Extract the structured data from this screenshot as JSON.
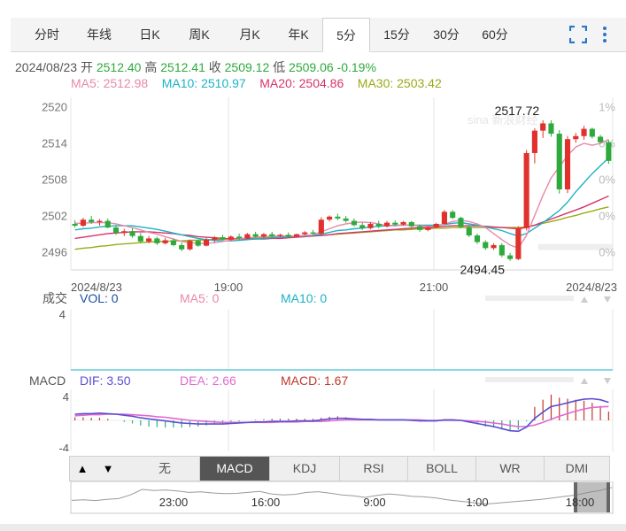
{
  "tabs": [
    "分时",
    "年线",
    "日K",
    "周K",
    "月K",
    "年K",
    "5分",
    "15分",
    "30分",
    "60分"
  ],
  "active_tab": "5分",
  "toolbar": {
    "fullscreen_icon": "fullscreen-icon",
    "more_icon": "more-vertical-icon"
  },
  "quote": {
    "date": "2024/08/23",
    "open_label": "开",
    "open": "2512.40",
    "high_label": "高",
    "high": "2512.41",
    "close_label": "收",
    "close": "2509.12",
    "low_label": "低",
    "low": "2509.06",
    "change": "-0.19%"
  },
  "ma": [
    {
      "label": "MA5: 2512.98",
      "color": "#e889a8"
    },
    {
      "label": "MA10: 2510.97",
      "color": "#1ab3c5"
    },
    {
      "label": "MA20: 2504.86",
      "color": "#d6336c"
    },
    {
      "label": "MA30: 2503.42",
      "color": "#9aaa16"
    }
  ],
  "watermark": "sina 新浪财经",
  "volume": {
    "title": "成交",
    "vol": "VOL: 0",
    "ma5": "MA5: 0",
    "ma10": "MA10: 0",
    "ytick": "4"
  },
  "macd": {
    "title": "MACD",
    "dif": "DIF: 3.50",
    "dea": "DEA: 2.66",
    "macd": "MACD: 1.67",
    "yticks": [
      "4",
      "-4"
    ]
  },
  "indicator_tabs": [
    "无",
    "MACD",
    "KDJ",
    "RSI",
    "BOLL",
    "WR",
    "DMI"
  ],
  "active_indicator": "MACD",
  "nav_arrows": [
    "▲",
    "▼"
  ],
  "navigator_labels": [
    "23:00",
    "16:00",
    "9:00",
    "1:00",
    "18:00"
  ],
  "colors": {
    "up": "#e0312c",
    "down": "#2eaa3c",
    "dif": "#5b4fd1",
    "dea": "#e06ad0",
    "accent": "#2c74c8"
  },
  "chart_data": [
    {
      "type": "candlestick",
      "title": "",
      "yticks": [
        2520,
        2514,
        2508,
        2502,
        2496
      ],
      "ylim": [
        2493.0,
        2521.5
      ],
      "pct_ticks": [
        "1%",
        "0%",
        "0%",
        "0%",
        "0%"
      ],
      "xlabels": [
        "2024/8/23",
        "19:00",
        "21:00",
        "2024/8/23"
      ],
      "annotations": {
        "max": "2517.72",
        "min": "2494.45"
      },
      "ohlc": [
        [
          2500.6,
          2501.2,
          2500.0,
          2500.3
        ],
        [
          2500.3,
          2501.6,
          2500.1,
          2501.3
        ],
        [
          2501.3,
          2501.9,
          2500.6,
          2500.9
        ],
        [
          2500.9,
          2501.4,
          2500.3,
          2501.1
        ],
        [
          2501.1,
          2501.5,
          2499.9,
          2500.0
        ],
        [
          2500.0,
          2500.4,
          2498.8,
          2499.1
        ],
        [
          2499.1,
          2499.8,
          2498.6,
          2499.4
        ],
        [
          2499.4,
          2499.9,
          2498.3,
          2498.6
        ],
        [
          2498.6,
          2499.1,
          2497.4,
          2497.7
        ],
        [
          2497.7,
          2498.6,
          2497.4,
          2498.2
        ],
        [
          2498.2,
          2498.5,
          2497.1,
          2497.4
        ],
        [
          2497.4,
          2498.3,
          2497.2,
          2497.9
        ],
        [
          2497.9,
          2498.2,
          2496.9,
          2497.1
        ],
        [
          2497.1,
          2497.5,
          2496.1,
          2496.4
        ],
        [
          2496.4,
          2498.0,
          2496.2,
          2497.8
        ],
        [
          2497.8,
          2498.0,
          2496.8,
          2497.0
        ],
        [
          2497.0,
          2498.3,
          2496.9,
          2498.0
        ],
        [
          2498.0,
          2498.6,
          2497.5,
          2498.4
        ],
        [
          2498.4,
          2498.8,
          2497.8,
          2498.0
        ],
        [
          2498.0,
          2498.7,
          2497.8,
          2498.5
        ],
        [
          2498.5,
          2499.0,
          2497.9,
          2498.2
        ],
        [
          2498.2,
          2499.1,
          2498.1,
          2498.9
        ],
        [
          2498.9,
          2499.3,
          2498.3,
          2498.5
        ],
        [
          2498.5,
          2499.1,
          2498.3,
          2498.9
        ],
        [
          2498.9,
          2499.3,
          2498.4,
          2498.6
        ],
        [
          2498.6,
          2499.0,
          2498.4,
          2498.8
        ],
        [
          2498.8,
          2499.2,
          2498.3,
          2498.5
        ],
        [
          2498.5,
          2499.0,
          2498.4,
          2498.9
        ],
        [
          2498.9,
          2499.4,
          2498.7,
          2499.2
        ],
        [
          2499.2,
          2499.6,
          2498.8,
          2499.0
        ],
        [
          2499.0,
          2501.7,
          2498.9,
          2501.3
        ],
        [
          2501.3,
          2502.0,
          2501.0,
          2501.8
        ],
        [
          2501.8,
          2502.3,
          2501.2,
          2501.5
        ],
        [
          2501.5,
          2501.9,
          2500.8,
          2501.1
        ],
        [
          2501.1,
          2501.5,
          2500.2,
          2500.4
        ],
        [
          2500.4,
          2500.8,
          2499.6,
          2499.9
        ],
        [
          2499.9,
          2500.9,
          2499.7,
          2500.6
        ],
        [
          2500.6,
          2501.1,
          2499.9,
          2500.2
        ],
        [
          2500.2,
          2501.1,
          2500.0,
          2500.8
        ],
        [
          2500.8,
          2501.2,
          2500.2,
          2500.5
        ],
        [
          2500.5,
          2501.1,
          2500.3,
          2500.9
        ],
        [
          2500.9,
          2501.1,
          2500.0,
          2500.2
        ],
        [
          2500.2,
          2500.5,
          2499.3,
          2499.6
        ],
        [
          2499.6,
          2500.2,
          2499.4,
          2500.0
        ],
        [
          2500.0,
          2500.8,
          2499.9,
          2500.6
        ],
        [
          2500.6,
          2502.9,
          2500.5,
          2502.6
        ],
        [
          2502.6,
          2502.9,
          2501.4,
          2501.6
        ],
        [
          2501.6,
          2501.8,
          2499.9,
          2500.1
        ],
        [
          2500.1,
          2500.4,
          2498.4,
          2498.7
        ],
        [
          2498.7,
          2499.0,
          2497.3,
          2497.6
        ],
        [
          2497.6,
          2497.9,
          2496.3,
          2496.6
        ],
        [
          2496.6,
          2497.4,
          2496.3,
          2497.1
        ],
        [
          2497.1,
          2497.4,
          2495.1,
          2495.4
        ],
        [
          2495.4,
          2495.8,
          2494.5,
          2494.8
        ],
        [
          2494.8,
          2500.2,
          2494.6,
          2499.9
        ],
        [
          2499.9,
          2512.8,
          2499.5,
          2512.3
        ],
        [
          2512.3,
          2516.4,
          2510.6,
          2516.0
        ],
        [
          2516.0,
          2517.7,
          2514.8,
          2517.2
        ],
        [
          2517.2,
          2517.7,
          2515.0,
          2515.5
        ],
        [
          2515.5,
          2516.1,
          2505.6,
          2506.3
        ],
        [
          2506.3,
          2515.1,
          2505.7,
          2514.6
        ],
        [
          2514.6,
          2515.6,
          2514.0,
          2515.1
        ],
        [
          2515.1,
          2516.8,
          2514.5,
          2516.3
        ],
        [
          2516.3,
          2516.5,
          2514.7,
          2515.0
        ],
        [
          2515.0,
          2515.3,
          2513.9,
          2514.1
        ],
        [
          2514.1,
          2514.5,
          2510.5,
          2511.0
        ]
      ],
      "ma5": [
        2500.7,
        2500.7,
        2500.8,
        2500.8,
        2500.8,
        2500.6,
        2500.3,
        2500.0,
        2499.6,
        2499.2,
        2498.9,
        2498.5,
        2498.1,
        2497.7,
        2497.5,
        2497.4,
        2497.4,
        2497.5,
        2497.7,
        2497.9,
        2498.1,
        2498.3,
        2498.4,
        2498.5,
        2498.6,
        2498.6,
        2498.6,
        2498.6,
        2498.7,
        2498.8,
        2499.3,
        2499.8,
        2500.3,
        2500.6,
        2500.8,
        2500.9,
        2500.8,
        2500.6,
        2500.3,
        2500.3,
        2500.4,
        2500.4,
        2500.3,
        2500.2,
        2500.2,
        2500.6,
        2501.0,
        2501.2,
        2501.0,
        2500.6,
        2500.0,
        2499.0,
        2498.0,
        2497.1,
        2496.6,
        2498.7,
        2502.0,
        2505.3,
        2508.2,
        2510.0,
        2511.9,
        2513.3,
        2513.9,
        2513.6,
        2513.9,
        2514.5
      ],
      "ma10": [
        2499.6,
        2499.8,
        2499.9,
        2500.1,
        2500.2,
        2500.3,
        2500.3,
        2500.3,
        2500.1,
        2499.9,
        2499.7,
        2499.4,
        2499.1,
        2498.8,
        2498.5,
        2498.2,
        2498.0,
        2497.9,
        2497.8,
        2497.8,
        2497.9,
        2498.0,
        2498.1,
        2498.2,
        2498.3,
        2498.4,
        2498.5,
        2498.6,
        2498.6,
        2498.7,
        2498.9,
        2499.2,
        2499.5,
        2499.6,
        2499.8,
        2499.9,
        2500.1,
        2500.2,
        2500.3,
        2500.4,
        2500.4,
        2500.4,
        2500.4,
        2500.4,
        2500.4,
        2500.5,
        2500.7,
        2500.8,
        2500.6,
        2500.4,
        2500.1,
        2499.8,
        2499.5,
        2499.0,
        2498.6,
        2499.0,
        2499.9,
        2500.8,
        2501.8,
        2502.8,
        2504.2,
        2505.9,
        2507.4,
        2508.9,
        2510.2,
        2511.5
      ],
      "ma20": [
        2498.2,
        2498.4,
        2498.6,
        2498.8,
        2499.0,
        2499.1,
        2499.2,
        2499.3,
        2499.3,
        2499.3,
        2499.2,
        2499.1,
        2499.0,
        2498.8,
        2498.7,
        2498.5,
        2498.4,
        2498.3,
        2498.2,
        2498.1,
        2498.1,
        2498.1,
        2498.1,
        2498.1,
        2498.2,
        2498.2,
        2498.3,
        2498.4,
        2498.5,
        2498.6,
        2498.7,
        2498.8,
        2499.0,
        2499.1,
        2499.2,
        2499.3,
        2499.4,
        2499.5,
        2499.6,
        2499.7,
        2499.8,
        2499.9,
        2500.0,
        2500.0,
        2500.1,
        2500.2,
        2500.3,
        2500.3,
        2500.3,
        2500.3,
        2500.2,
        2500.1,
        2500.0,
        2499.9,
        2499.8,
        2500.0,
        2500.4,
        2500.9,
        2501.4,
        2501.9,
        2502.4,
        2502.9,
        2503.4,
        2504.0,
        2504.6,
        2505.2
      ],
      "ma30": [
        2496.4,
        2496.6,
        2496.7,
        2496.9,
        2497.0,
        2497.2,
        2497.3,
        2497.4,
        2497.5,
        2497.6,
        2497.7,
        2497.7,
        2497.8,
        2497.8,
        2497.9,
        2497.9,
        2498.0,
        2498.0,
        2498.1,
        2498.1,
        2498.2,
        2498.2,
        2498.3,
        2498.3,
        2498.4,
        2498.4,
        2498.5,
        2498.5,
        2498.6,
        2498.6,
        2498.7,
        2498.8,
        2498.9,
        2499.0,
        2499.1,
        2499.2,
        2499.3,
        2499.4,
        2499.5,
        2499.6,
        2499.6,
        2499.7,
        2499.8,
        2499.8,
        2499.9,
        2499.9,
        2500.0,
        2500.0,
        2500.0,
        2500.0,
        2500.0,
        2500.0,
        2500.0,
        2500.0,
        2500.0,
        2500.1,
        2500.4,
        2500.7,
        2501.0,
        2501.3,
        2501.7,
        2502.0,
        2502.4,
        2502.7,
        2503.1,
        2503.4
      ]
    },
    {
      "type": "bar",
      "title": "MACD",
      "ylim": [
        -6,
        6
      ],
      "yticks": [
        4,
        -4
      ],
      "dif": [
        1.2,
        1.3,
        1.3,
        1.4,
        1.3,
        1.2,
        1.0,
        0.8,
        0.5,
        0.3,
        0.1,
        -0.1,
        -0.3,
        -0.5,
        -0.6,
        -0.7,
        -0.7,
        -0.7,
        -0.7,
        -0.6,
        -0.5,
        -0.4,
        -0.3,
        -0.3,
        -0.2,
        -0.2,
        -0.2,
        -0.1,
        -0.1,
        -0.1,
        0.1,
        0.3,
        0.4,
        0.4,
        0.3,
        0.2,
        0.2,
        0.1,
        0.1,
        0.1,
        0.1,
        0.0,
        -0.1,
        -0.1,
        -0.1,
        0.1,
        0.1,
        0.0,
        -0.3,
        -0.6,
        -0.9,
        -1.2,
        -1.6,
        -2.0,
        -2.1,
        -1.3,
        0.4,
        1.6,
        2.7,
        3.0,
        3.4,
        3.8,
        4.1,
        4.2,
        4.0,
        3.5
      ],
      "dea": [
        0.9,
        1.0,
        1.1,
        1.1,
        1.2,
        1.2,
        1.2,
        1.1,
        1.0,
        0.9,
        0.7,
        0.6,
        0.4,
        0.2,
        0.0,
        -0.1,
        -0.2,
        -0.3,
        -0.4,
        -0.4,
        -0.4,
        -0.4,
        -0.4,
        -0.4,
        -0.4,
        -0.3,
        -0.3,
        -0.3,
        -0.2,
        -0.2,
        -0.2,
        -0.1,
        0.0,
        0.1,
        0.1,
        0.1,
        0.1,
        0.1,
        0.1,
        0.1,
        0.1,
        0.1,
        0.1,
        0.0,
        0.0,
        0.0,
        0.0,
        0.0,
        -0.1,
        -0.2,
        -0.3,
        -0.5,
        -0.7,
        -1.0,
        -1.2,
        -1.2,
        -0.9,
        -0.4,
        0.2,
        0.8,
        1.3,
        1.8,
        2.2,
        2.5,
        2.6,
        2.7
      ],
      "macd": [
        0.6,
        0.6,
        0.5,
        0.5,
        0.3,
        0.0,
        -0.3,
        -0.6,
        -1.0,
        -1.2,
        -1.3,
        -1.4,
        -1.4,
        -1.4,
        -1.3,
        -1.2,
        -1.0,
        -0.8,
        -0.6,
        -0.4,
        -0.2,
        0.0,
        0.1,
        0.2,
        0.3,
        0.3,
        0.3,
        0.3,
        0.3,
        0.3,
        0.5,
        0.7,
        0.8,
        0.6,
        0.4,
        0.2,
        0.1,
        0.0,
        0.0,
        0.0,
        0.0,
        -0.1,
        -0.2,
        -0.2,
        -0.2,
        0.1,
        0.2,
        0.0,
        -0.4,
        -0.8,
        -1.2,
        -1.4,
        -1.8,
        -2.0,
        -1.8,
        -0.2,
        2.6,
        4.0,
        5.0,
        4.4,
        4.2,
        4.0,
        3.8,
        3.4,
        2.8,
        1.7
      ]
    }
  ]
}
